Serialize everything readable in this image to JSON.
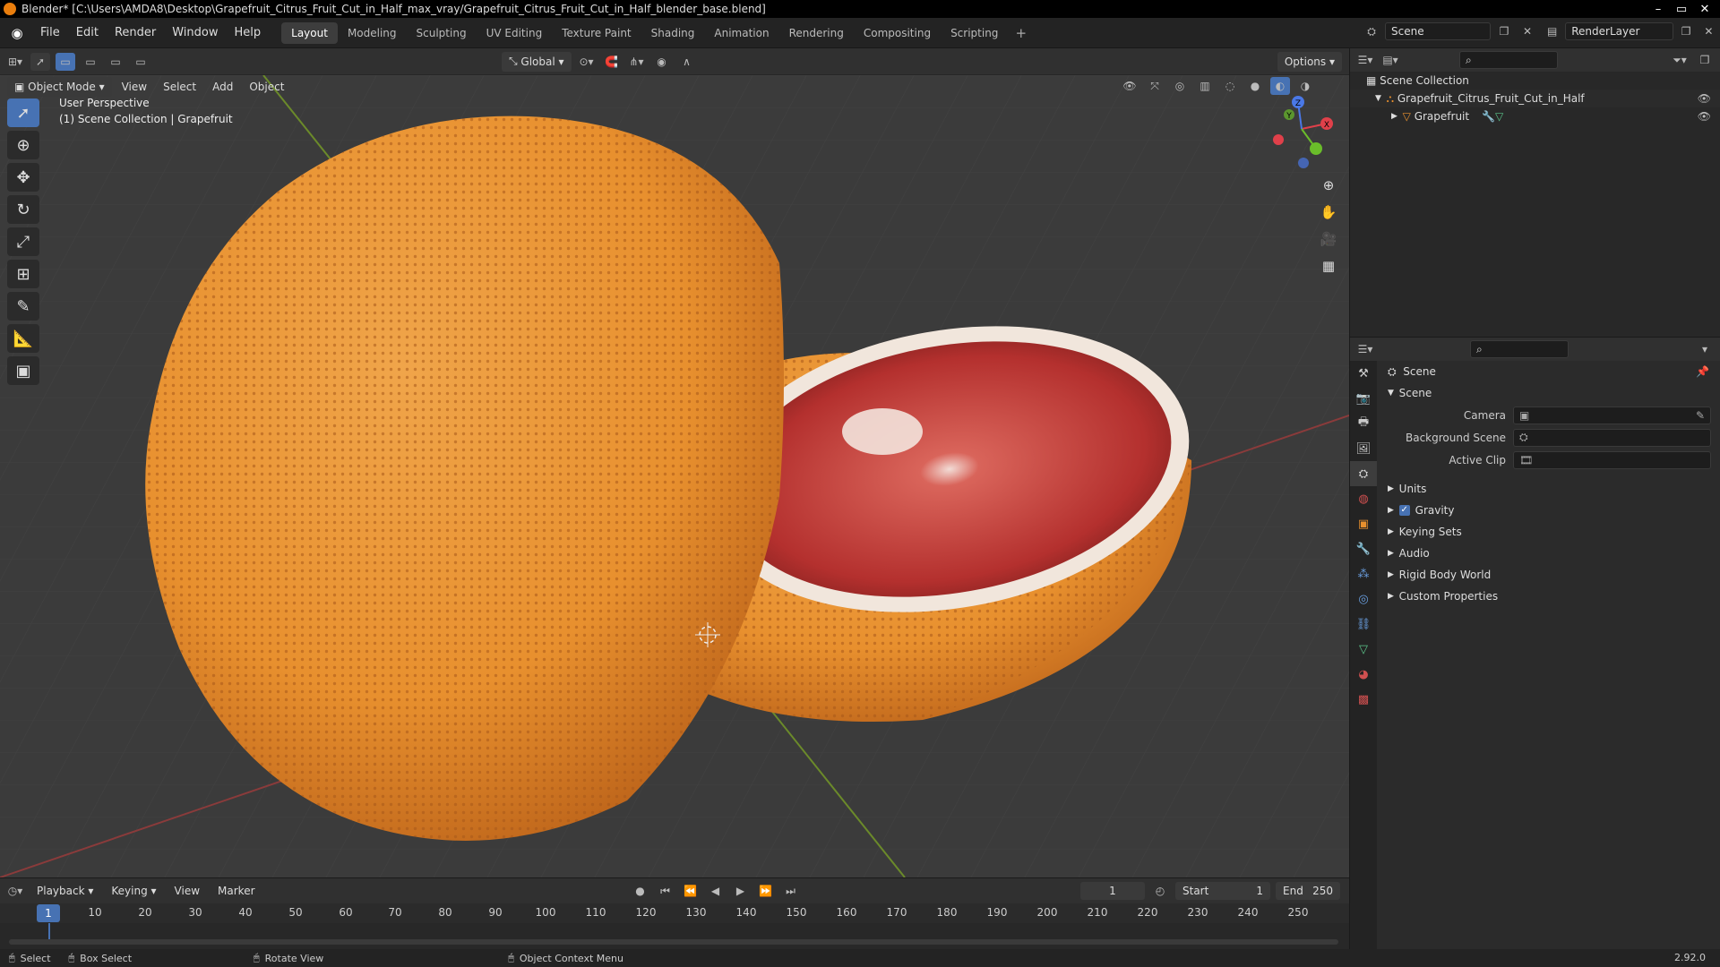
{
  "titlebar": {
    "title": "Blender* [C:\\Users\\AMDA8\\Desktop\\Grapefruit_Citrus_Fruit_Cut_in_Half_max_vray/Grapefruit_Citrus_Fruit_Cut_in_Half_blender_base.blend]",
    "min": "–",
    "max": "▭",
    "close": "✕"
  },
  "menu": [
    "File",
    "Edit",
    "Render",
    "Window",
    "Help"
  ],
  "workspaces": [
    "Layout",
    "Modeling",
    "Sculpting",
    "UV Editing",
    "Texture Paint",
    "Shading",
    "Animation",
    "Rendering",
    "Compositing",
    "Scripting"
  ],
  "workspace_add": "+",
  "scene_name": "Scene",
  "render_layer": "RenderLayer",
  "viewport": {
    "transform_orientation": "Global",
    "options_label": "Options",
    "mode": "Object Mode",
    "header_menus": [
      "View",
      "Select",
      "Add",
      "Object"
    ],
    "perspective": "User Perspective",
    "collection_info": "(1) Scene Collection | Grapefruit",
    "gizmo": {
      "x": "X",
      "y": "Y",
      "z": "Z"
    }
  },
  "outliner": {
    "root": "Scene Collection",
    "items": [
      {
        "name": "Grapefruit_Citrus_Fruit_Cut_in_Half"
      },
      {
        "name": "Grapefruit"
      }
    ]
  },
  "properties": {
    "context": "Scene",
    "section": "Scene",
    "fields": [
      {
        "label": "Camera"
      },
      {
        "label": "Background Scene"
      },
      {
        "label": "Active Clip"
      }
    ],
    "panels": [
      {
        "name": "Units"
      },
      {
        "name": "Gravity",
        "checked": true
      },
      {
        "name": "Keying Sets"
      },
      {
        "name": "Audio"
      },
      {
        "name": "Rigid Body World"
      },
      {
        "name": "Custom Properties"
      }
    ]
  },
  "timeline": {
    "menus": [
      "Playback",
      "Keying",
      "View",
      "Marker"
    ],
    "current_frame": "1",
    "start_label": "Start",
    "start": "1",
    "end_label": "End",
    "end": "250",
    "ticks": [
      "10",
      "20",
      "30",
      "40",
      "50",
      "60",
      "70",
      "80",
      "90",
      "100",
      "110",
      "120",
      "130",
      "140",
      "150",
      "160",
      "170",
      "180",
      "190",
      "200",
      "210",
      "220",
      "230",
      "240",
      "250"
    ]
  },
  "status": {
    "select": "Select",
    "box_select": "Box Select",
    "rotate_view": "Rotate View",
    "context_menu": "Object Context Menu",
    "version": "2.92.0"
  },
  "colors": {
    "accent": "#4772b3",
    "peel": "#e8902e",
    "flesh": "#c63a3a"
  }
}
